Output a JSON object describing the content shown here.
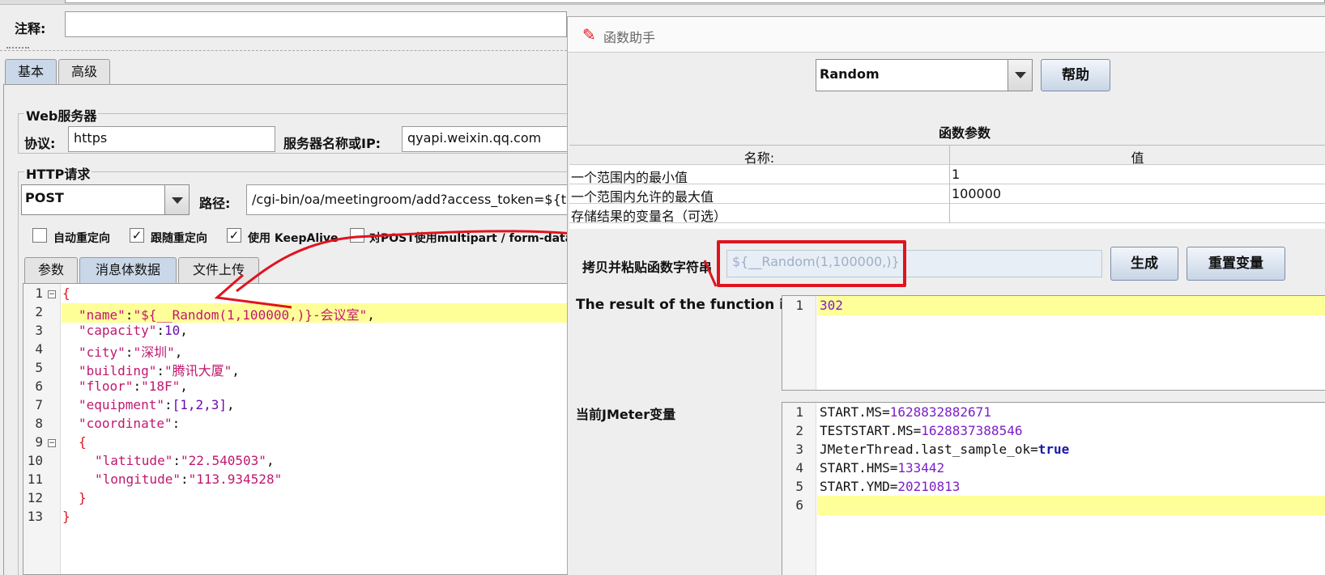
{
  "top_form": {
    "comment_label": "注释:"
  },
  "tabs_main": {
    "basic": "基本",
    "advanced": "高级"
  },
  "web_server": {
    "section_title": "Web服务器",
    "protocol_label": "协议:",
    "protocol_value": "https",
    "server_label": "服务器名称或IP:",
    "server_value": "qyapi.weixin.qq.com"
  },
  "http_request": {
    "section_title": "HTTP请求",
    "method_value": "POST",
    "path_label": "路径:",
    "path_value": "/cgi-bin/oa/meetingroom/add?access_token=${tok",
    "checkboxes": [
      {
        "label": "自动重定向",
        "checked": ""
      },
      {
        "label": "跟随重定向",
        "checked": "✓"
      },
      {
        "label": "使用 KeepAlive",
        "checked": "✓"
      },
      {
        "label": "对POST使用multipart / form-data",
        "checked": ""
      }
    ]
  },
  "body_tabs": {
    "params": "参数",
    "body": "消息体数据",
    "files": "文件上传"
  },
  "body_lines": [
    {
      "num": "1",
      "text": "{"
    },
    {
      "num": "2",
      "key": "\"name\"",
      "sep": ":",
      "value": "\"${__Random(1,100000,)}-会议室\"",
      "tail": ","
    },
    {
      "num": "3",
      "key": "\"capacity\"",
      "sep": ":",
      "value": "10",
      "tail": ","
    },
    {
      "num": "4",
      "key": "\"city\"",
      "sep": ":",
      "value": "\"深圳\"",
      "tail": ","
    },
    {
      "num": "5",
      "key": "\"building\"",
      "sep": ":",
      "value": "\"腾讯大厦\"",
      "tail": ","
    },
    {
      "num": "6",
      "key": "\"floor\"",
      "sep": ":",
      "value": "\"18F\"",
      "tail": ","
    },
    {
      "num": "7",
      "key": "\"equipment\"",
      "sep": ":",
      "value": "[1,2,3]",
      "tail": ","
    },
    {
      "num": "8",
      "key": "\"coordinate\"",
      "sep": ":",
      "value": "",
      "tail": ""
    },
    {
      "num": "9",
      "text": "{"
    },
    {
      "num": "10",
      "key": "\"latitude\"",
      "sep": ":",
      "value": "\"22.540503\"",
      "tail": ","
    },
    {
      "num": "11",
      "key": "\"longitude\"",
      "sep": ":",
      "value": "\"113.934528\"",
      "tail": ""
    },
    {
      "num": "12",
      "text": "}"
    },
    {
      "num": "13",
      "text": "}"
    }
  ],
  "dialog": {
    "title": "函数助手",
    "function_select": "Random",
    "help_button": "帮助",
    "params_title": "函数参数",
    "col_name": "名称:",
    "col_value": "值",
    "params": [
      {
        "name": "一个范围内的最小值",
        "value": "1"
      },
      {
        "name": "一个范围内允许的最大值",
        "value": "100000"
      },
      {
        "name": "存储结果的变量名（可选）",
        "value": ""
      }
    ],
    "copy_label": "拷贝并粘贴函数字符串",
    "function_string": "${__Random(1,100000,)}",
    "generate_button": "生成",
    "reset_button": "重置变量",
    "result_label": "The result of the function is",
    "result_lines": [
      {
        "num": "1",
        "text": "302"
      }
    ],
    "vars_label": "当前JMeter变量",
    "vars_lines": [
      {
        "num": "1",
        "key": "START.MS",
        "value": "1628832882671"
      },
      {
        "num": "2",
        "key": "TESTSTART.MS",
        "value": "1628837388546"
      },
      {
        "num": "3",
        "key": "JMeterThread.last_sample_ok",
        "value": "true"
      },
      {
        "num": "4",
        "key": "START.HMS",
        "value": "133442"
      },
      {
        "num": "5",
        "key": "START.YMD",
        "value": "20210813"
      },
      {
        "num": "6",
        "key": "",
        "value": ""
      }
    ]
  },
  "colors": {
    "highlight": "#ffff99",
    "annotation": "#e0141e",
    "string": "#c0186f",
    "number": "#6a0dad"
  }
}
